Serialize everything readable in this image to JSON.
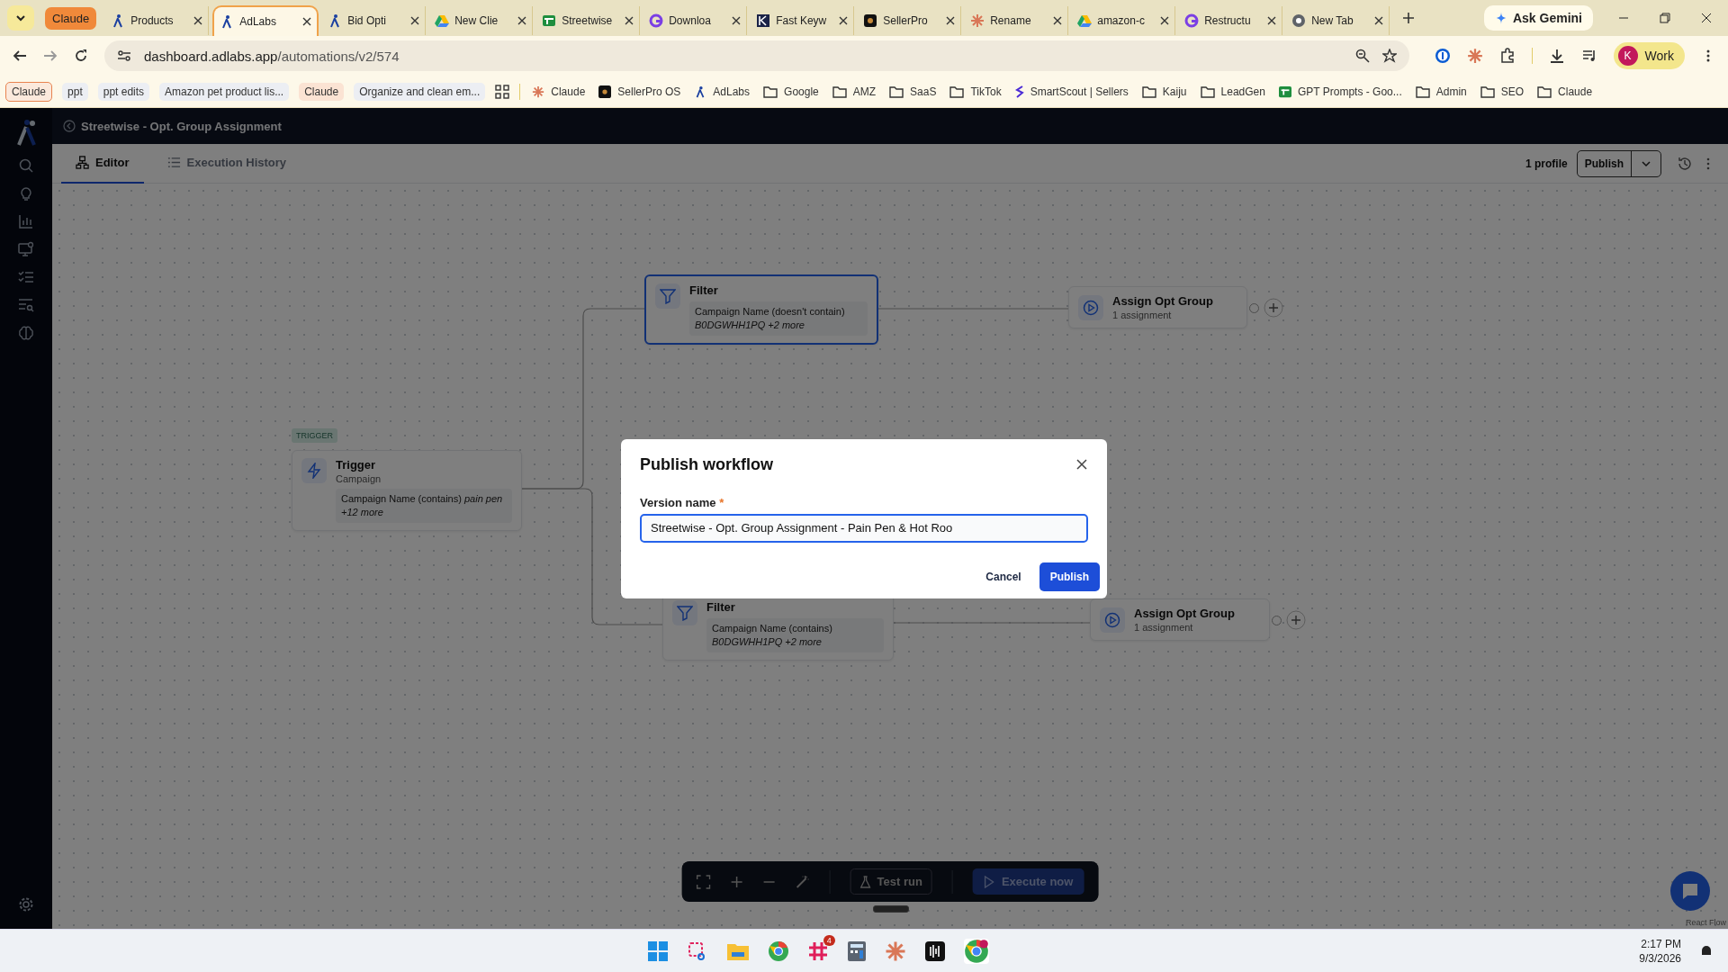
{
  "browser": {
    "group_label": "Claude",
    "tabs": [
      {
        "title": "Products",
        "selected": false
      },
      {
        "title": "AdLabs",
        "selected": true
      },
      {
        "title": "Bid Opti",
        "selected": false
      },
      {
        "title": "New Clie",
        "selected": false
      },
      {
        "title": "Streetwise",
        "selected": false
      },
      {
        "title": "Downloa",
        "selected": false
      },
      {
        "title": "Fast Keyw",
        "selected": false
      },
      {
        "title": "SellerPro",
        "selected": false
      },
      {
        "title": "Rename",
        "selected": false
      },
      {
        "title": "amazon-c",
        "selected": false
      },
      {
        "title": "Restructu",
        "selected": false
      },
      {
        "title": "New Tab",
        "selected": false
      }
    ],
    "gemini": "Ask Gemini",
    "url_host": "dashboard.adlabs.app",
    "url_path": "/automations/v2/574",
    "profile_initial": "K",
    "profile_name": "Work",
    "chips": [
      {
        "label": "Claude",
        "kind": "outlined"
      },
      {
        "label": "ppt",
        "kind": "plain"
      },
      {
        "label": "ppt edits",
        "kind": "plain"
      },
      {
        "label": "Amazon pet product lis...",
        "kind": "plain"
      },
      {
        "label": "Claude",
        "kind": "peach"
      },
      {
        "label": "Organize and clean em...",
        "kind": "plain"
      }
    ],
    "bookmarks": [
      {
        "label": "Claude",
        "kind": "sunburst"
      },
      {
        "label": "SellerPro OS",
        "kind": "sp"
      },
      {
        "label": "AdLabs",
        "kind": "adlabs"
      },
      {
        "label": "Google",
        "kind": "folder"
      },
      {
        "label": "AMZ",
        "kind": "folder"
      },
      {
        "label": "SaaS",
        "kind": "folder"
      },
      {
        "label": "TikTok",
        "kind": "folder"
      },
      {
        "label": "SmartScout | Sellers",
        "kind": "smartscout"
      },
      {
        "label": "Kaiju",
        "kind": "folder"
      },
      {
        "label": "LeadGen",
        "kind": "folder"
      },
      {
        "label": "GPT Prompts - Goo...",
        "kind": "sheet"
      },
      {
        "label": "Admin",
        "kind": "folder"
      },
      {
        "label": "SEO",
        "kind": "folder"
      },
      {
        "label": "Claude",
        "kind": "folder"
      }
    ]
  },
  "app": {
    "title": "Streetwise - Opt. Group Assignment",
    "tabs": [
      {
        "label": "Editor",
        "selected": true
      },
      {
        "label": "Execution History",
        "selected": false
      }
    ],
    "profiles": "1 profile",
    "publish": "Publish",
    "trigger_tag": "TRIGGER",
    "nodes": [
      {
        "kind": "trigger",
        "title": "Trigger",
        "subtitle": "Campaign",
        "condition": "Campaign Name (contains) *pain pen +12 more*"
      },
      {
        "kind": "filter",
        "title": "Filter",
        "condition": "Campaign Name (doesn't contain)",
        "values": "B0DGWHH1PQ +2 more",
        "selected": true
      },
      {
        "kind": "action",
        "title": "Assign Opt Group",
        "subtitle": "1 assignment"
      },
      {
        "kind": "filter",
        "title": "Filter",
        "condition": "Campaign Name (contains)",
        "values": "B0DGWHH1PQ +2 more",
        "selected": false
      },
      {
        "kind": "action",
        "title": "Assign Opt Group",
        "subtitle": "1 assignment"
      }
    ],
    "toolbar": {
      "test": "Test run",
      "execute": "Execute now"
    },
    "attribution": "React Flow"
  },
  "dialog": {
    "title": "Publish workflow",
    "label": "Version name",
    "required_mark": "*",
    "value": "Streetwise - Opt. Group Assignment - Pain Pen & Hot Roo",
    "cancel": "Cancel",
    "confirm": "Publish"
  },
  "taskbar": {
    "slack_badge": "4",
    "time": "2:17 PM",
    "date": "9/3/2026"
  }
}
